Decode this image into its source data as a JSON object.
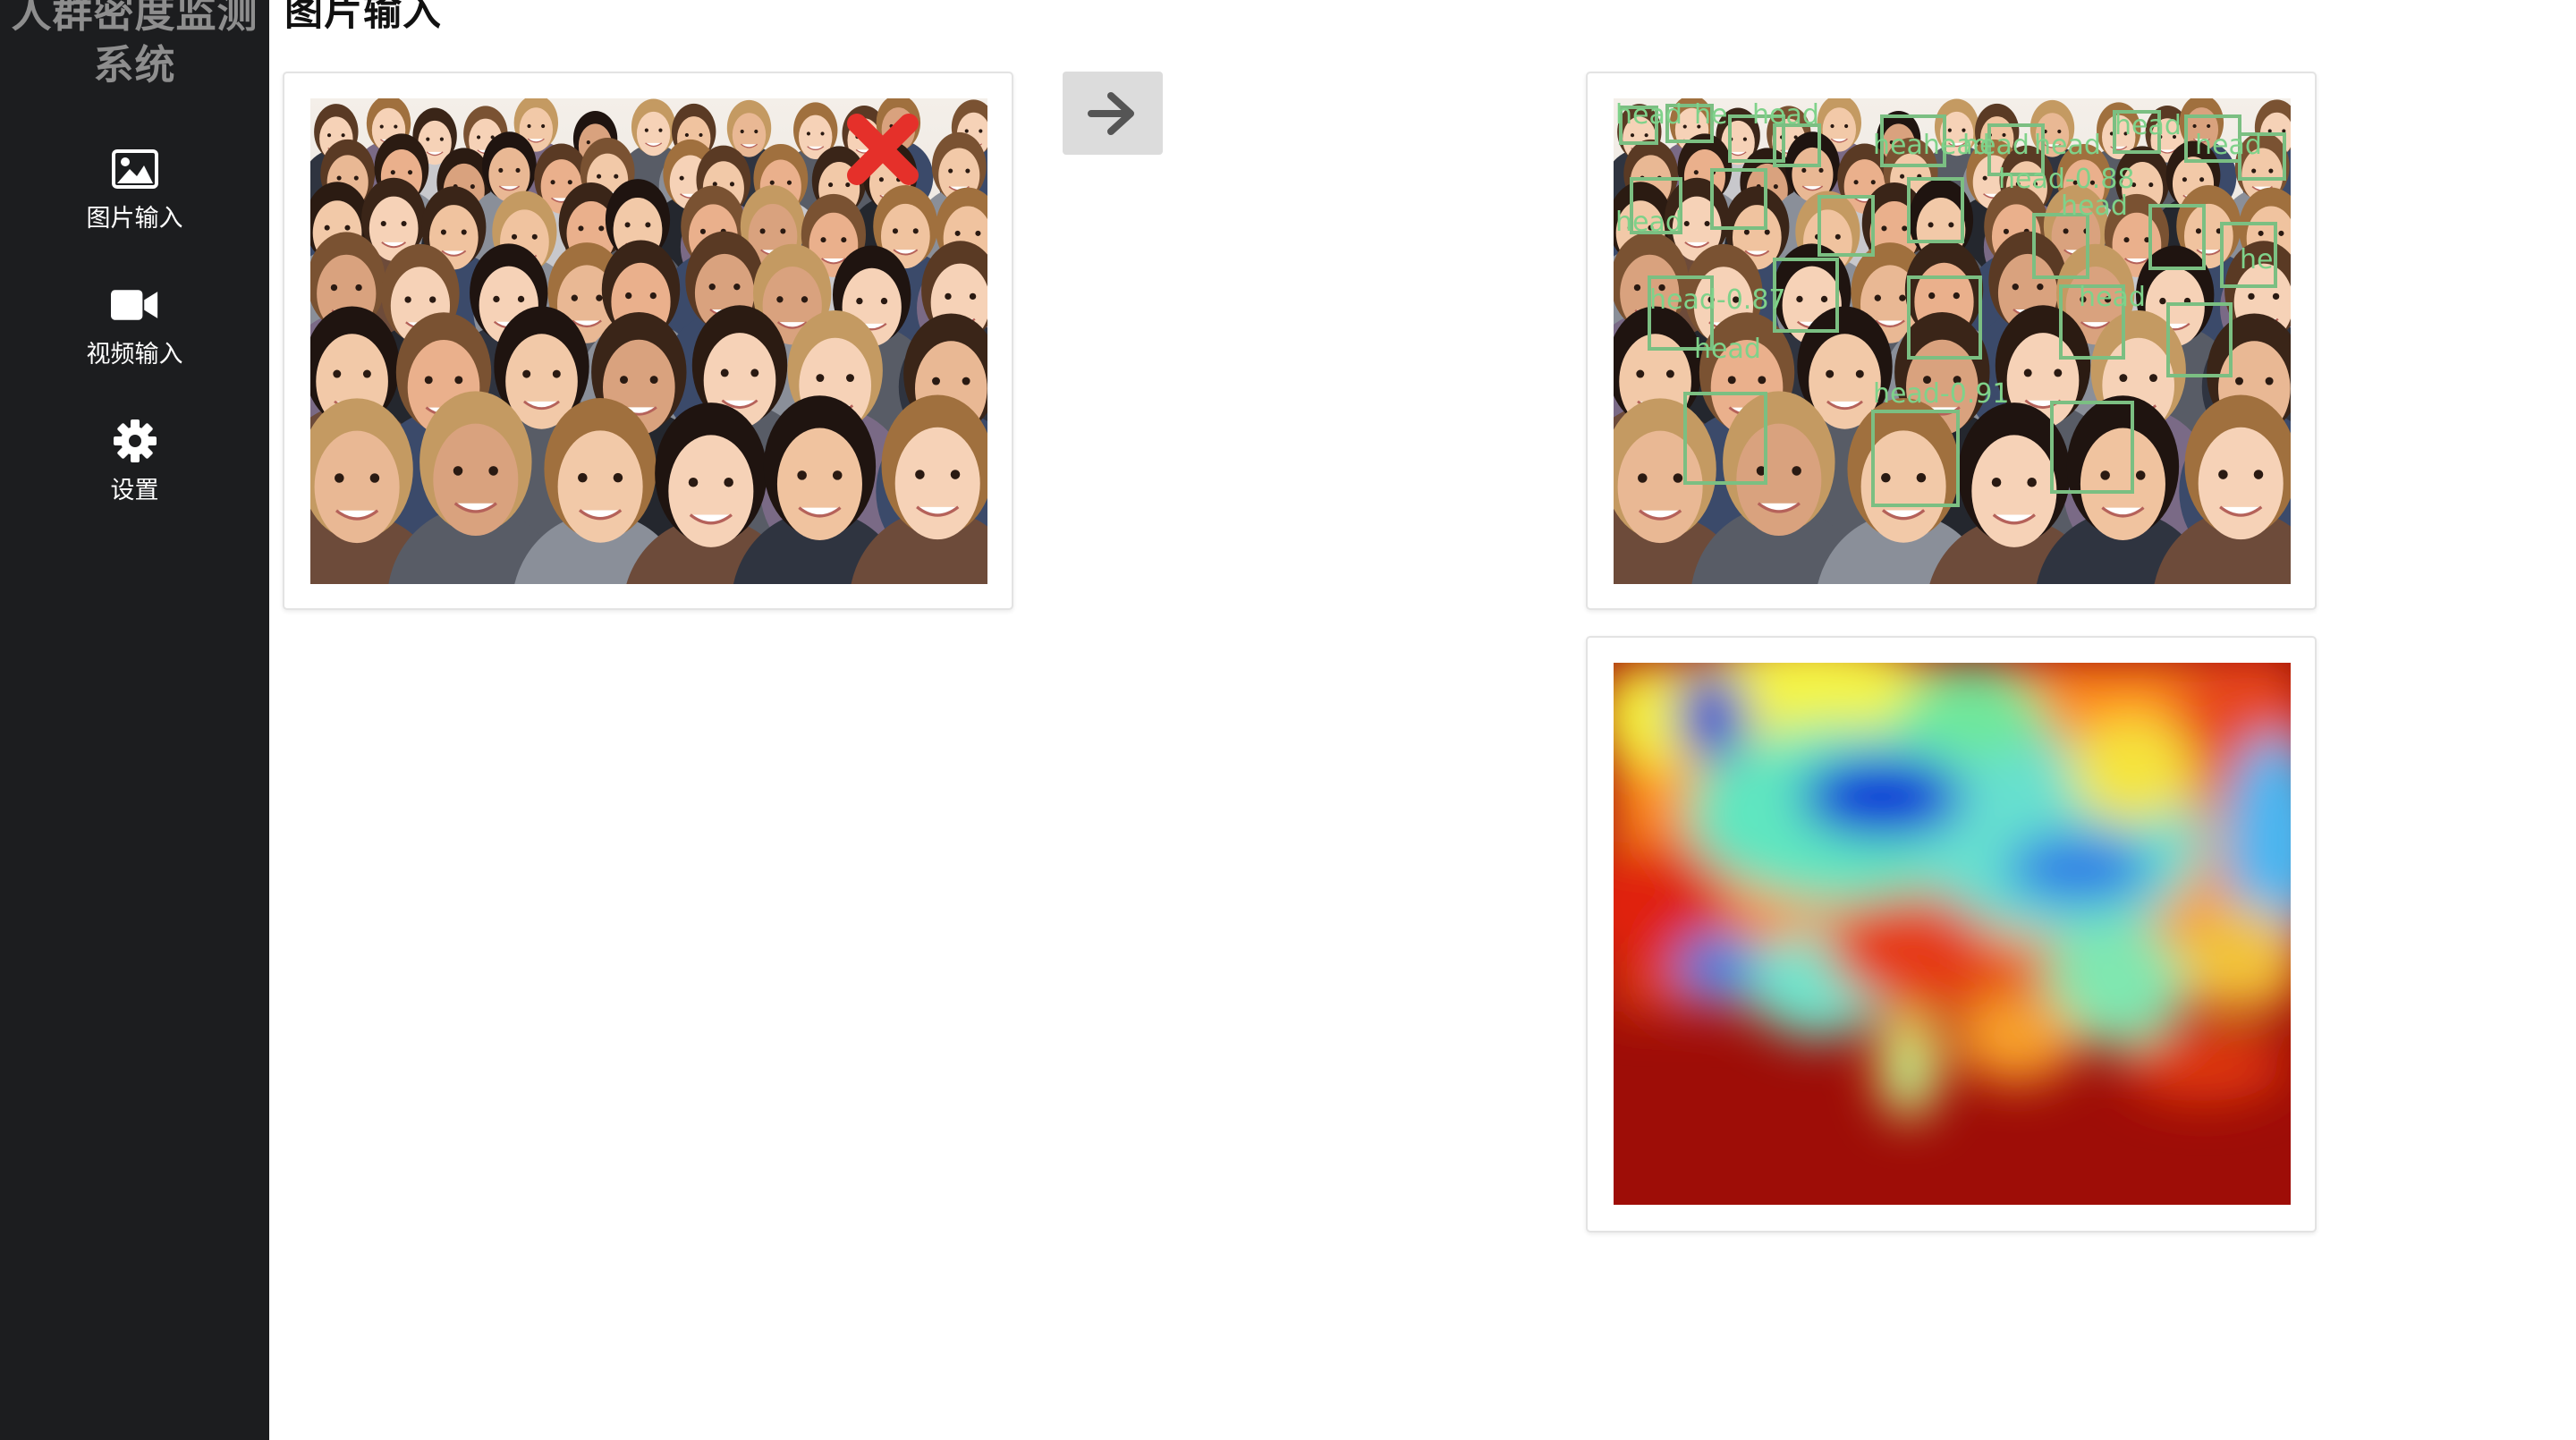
{
  "sidebar": {
    "app_title_line1": "人群密度监测",
    "app_title_line2": "系统",
    "items": [
      {
        "label": "图片输入",
        "icon": "image-icon"
      },
      {
        "label": "视频输入",
        "icon": "video-camera-icon"
      },
      {
        "label": "设置",
        "icon": "gear-icon"
      }
    ]
  },
  "main": {
    "title": "图片输入",
    "input_card": {
      "remove_icon": "close-x-icon",
      "remove_color": "#e5302a"
    },
    "run_button": {
      "icon": "arrow-right-icon"
    },
    "result_card": {
      "detections": [
        {
          "text": "head"
        },
        {
          "text": "he"
        },
        {
          "text": "head"
        },
        {
          "text": "heahead"
        },
        {
          "text": "head"
        },
        {
          "text": "head"
        },
        {
          "text": "head-0.88"
        },
        {
          "text": "head"
        },
        {
          "text": "head"
        },
        {
          "text": "head-0.87"
        },
        {
          "text": "head"
        },
        {
          "text": "head"
        },
        {
          "text": "head-0.91"
        },
        {
          "text": "head"
        },
        {
          "text": "head"
        },
        {
          "text": "he"
        }
      ]
    },
    "heatmap_card": {
      "colormap": "jet"
    }
  },
  "colors": {
    "sidebar_bg": "#1c1d1f",
    "box_green": "#7bbf82",
    "button_bg": "#dcdcdc"
  }
}
